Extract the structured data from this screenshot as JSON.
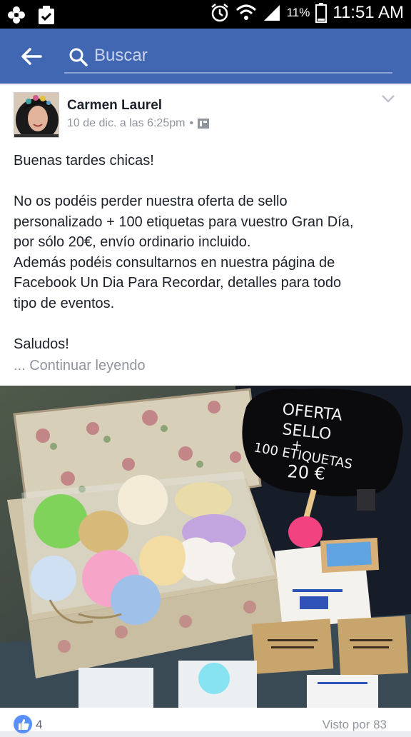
{
  "status_bar": {
    "battery_percent": "11%",
    "time": "11:51 AM"
  },
  "header": {
    "search_placeholder": "Buscar"
  },
  "post": {
    "author": "Carmen Laurel",
    "timestamp": "10 de dic. a las 6:25pm",
    "separator": "•",
    "paragraphs": [
      "Buenas tardes chicas!",
      "",
      "No os podéis perder nuestra oferta de sello",
      "personalizado + 100 etiquetas para vuestro Gran Día,",
      "por sólo 20€, envío ordinario incluido.",
      "Además podéis consultarnos en nuestra página de",
      "Facebook Un Dia Para Recordar, detalles para todo",
      "tipo de eventos.",
      "",
      "Saludos!"
    ],
    "continue_reading": "... Continuar leyendo",
    "photo": {
      "sign_lines": [
        "OFERTA",
        "SELLO",
        "+",
        "100 ETIQUETAS",
        "20 €"
      ]
    },
    "likes": "4",
    "seen_by": "Visto por 83"
  },
  "colors": {
    "brand": "#4267b2",
    "like": "#5890ff"
  }
}
